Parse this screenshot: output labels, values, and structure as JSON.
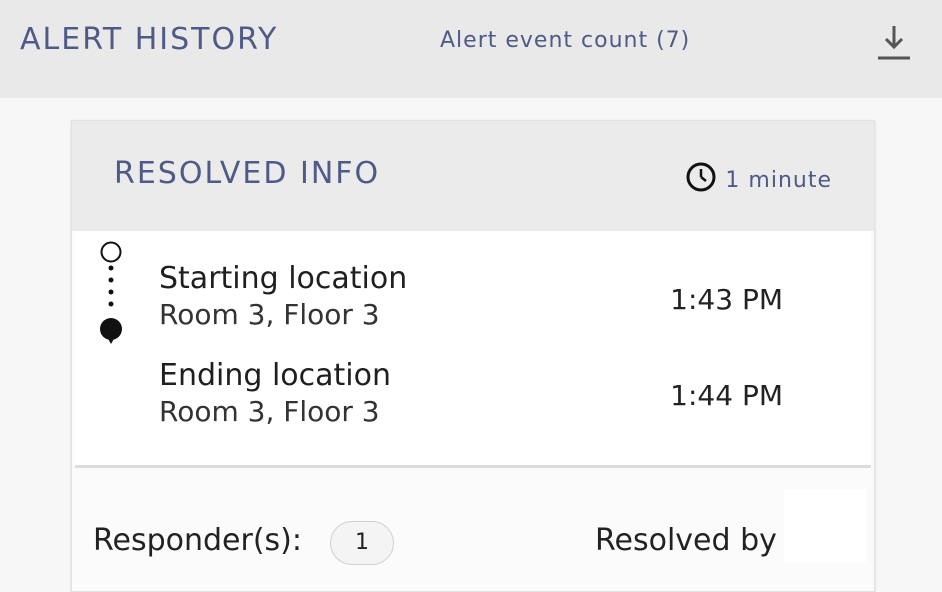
{
  "header": {
    "title": "ALERT HISTORY",
    "count_label": "Alert event count (7)",
    "download_icon": "download-icon"
  },
  "card": {
    "title": "RESOLVED INFO",
    "duration": "1 minute",
    "clock_icon": "clock-icon",
    "start": {
      "label": "Starting location",
      "place": "Room 3, Floor 3",
      "time": "1:43 PM"
    },
    "end": {
      "label": "Ending location",
      "place": "Room 3, Floor 3",
      "time": "1:44 PM"
    },
    "responders_label": "Responder(s):",
    "responders_count": "1",
    "resolved_by_label": "Resolved by"
  },
  "colors": {
    "accent": "#4f5a87",
    "header_bg": "#e9e9e9",
    "card_head_bg": "#ebebeb"
  }
}
